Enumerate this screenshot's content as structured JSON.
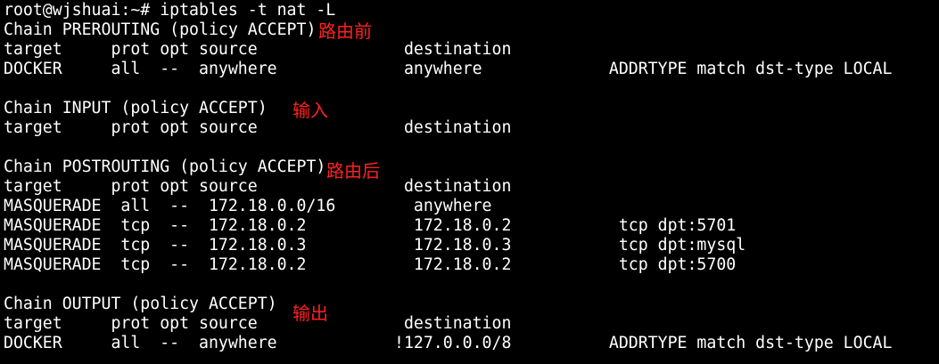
{
  "colors": {
    "background": "#000000",
    "text": "#ffffff",
    "annotation": "#ff2020"
  },
  "terminal": {
    "lines": [
      "root@wjshuai:~# iptables -t nat -L",
      "Chain PREROUTING (policy ACCEPT)",
      "target     prot opt source               destination",
      "DOCKER     all  --  anywhere             anywhere             ADDRTYPE match dst-type LOCAL",
      "",
      "Chain INPUT (policy ACCEPT)",
      "target     prot opt source               destination",
      "",
      "Chain POSTROUTING (policy ACCEPT)",
      "target     prot opt source               destination",
      "MASQUERADE  all  --  172.18.0.0/16        anywhere",
      "MASQUERADE  tcp  --  172.18.0.2           172.18.0.2           tcp dpt:5701",
      "MASQUERADE  tcp  --  172.18.0.3           172.18.0.3           tcp dpt:mysql",
      "MASQUERADE  tcp  --  172.18.0.2           172.18.0.2           tcp dpt:5700",
      "",
      "Chain OUTPUT (policy ACCEPT)",
      "target     prot opt source               destination",
      "DOCKER     all  --  anywhere            !127.0.0.0/8          ADDRTYPE match dst-type LOCAL"
    ]
  },
  "annotations": {
    "prerouting": "路由前",
    "input": "输入",
    "postrouting": "路由后",
    "output": "输出"
  }
}
